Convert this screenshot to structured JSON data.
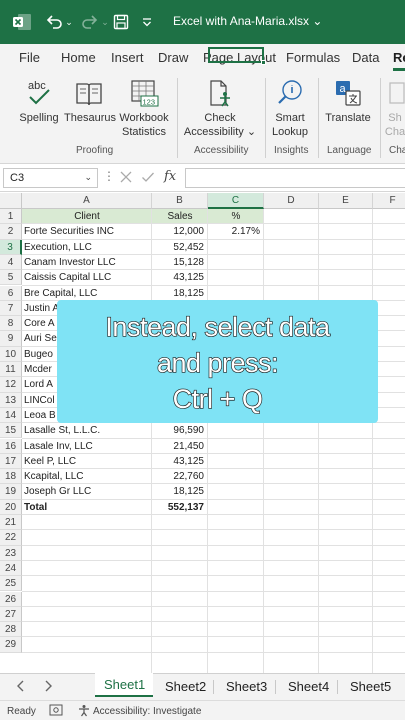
{
  "titlebar": {
    "file_name": "Excel with Ana-Maria.xlsx ⌄"
  },
  "ribbon_tabs": [
    "File",
    "Home",
    "Insert",
    "Draw",
    "Page Layout",
    "Formulas",
    "Data",
    "Re"
  ],
  "ribbon": {
    "spelling": "Spelling",
    "thesaurus": "Thesaurus",
    "workbook_statistics_1": "Workbook",
    "workbook_statistics_2": "Statistics",
    "check_accessibility_1": "Check",
    "check_accessibility_2": "Accessibility ⌄",
    "smart_lookup_1": "Smart",
    "smart_lookup_2": "Lookup",
    "translate": "Translate",
    "show_1": "Sh",
    "show_2": "Cha",
    "group_proofing": "Proofing",
    "group_accessibility": "Accessibility",
    "group_insights": "Insights",
    "group_language": "Language",
    "group_changes": "Cha",
    "stats_badge": "123",
    "abc_label": "abc"
  },
  "formula_bar": {
    "name_box": "C3",
    "fx": "fx",
    "formula": ""
  },
  "columns": [
    "A",
    "B",
    "C",
    "D",
    "E",
    "F"
  ],
  "rows": [
    "1",
    "2",
    "3",
    "4",
    "5",
    "6",
    "7",
    "8",
    "9",
    "10",
    "11",
    "12",
    "13",
    "14",
    "15",
    "16",
    "17",
    "18",
    "19",
    "20",
    "21",
    "22",
    "23",
    "24",
    "25",
    "26",
    "27",
    "28",
    "29"
  ],
  "header_row": {
    "client": "Client",
    "sales": "Sales",
    "pct": "%"
  },
  "data_rows": [
    {
      "client": "Forte Securities INC",
      "sales": "12,000",
      "pct": "2.17%"
    },
    {
      "client": "Execution, LLC",
      "sales": "52,452",
      "pct": ""
    },
    {
      "client": "Canam Investor LLC",
      "sales": "15,128",
      "pct": ""
    },
    {
      "client": "Caissis Capital LLC",
      "sales": "43,125",
      "pct": ""
    },
    {
      "client": "Bre Capital, LLC",
      "sales": "18,125",
      "pct": ""
    },
    {
      "client": "Justin A",
      "sales": "",
      "pct": ""
    },
    {
      "client": "Core A",
      "sales": "",
      "pct": ""
    },
    {
      "client": "Auri Se",
      "sales": "",
      "pct": ""
    },
    {
      "client": "Bugeo",
      "sales": "",
      "pct": ""
    },
    {
      "client": "Mcder",
      "sales": "",
      "pct": ""
    },
    {
      "client": "Lord A",
      "sales": "",
      "pct": ""
    },
    {
      "client": "LINCol",
      "sales": "",
      "pct": ""
    },
    {
      "client": "Leoa B",
      "sales": "",
      "pct": ""
    },
    {
      "client": "Lasalle St, L.L.C.",
      "sales": "96,590",
      "pct": ""
    },
    {
      "client": "Lasale Inv, LLC",
      "sales": "21,450",
      "pct": ""
    },
    {
      "client": "Keel P, LLC",
      "sales": "43,125",
      "pct": ""
    },
    {
      "client": "Kcapital, LLC",
      "sales": "22,760",
      "pct": ""
    },
    {
      "client": "Joseph Gr LLC",
      "sales": "18,125",
      "pct": ""
    }
  ],
  "total_row": {
    "label": "Total",
    "sales": "552,137"
  },
  "callout": {
    "line1": "Instead, select data",
    "line2": "and press:",
    "line3": "Ctrl + Q"
  },
  "sheets": [
    "Sheet1",
    "Sheet2",
    "Sheet3",
    "Sheet4",
    "Sheet5"
  ],
  "status": {
    "ready": "Ready",
    "accessibility": "Accessibility: Investigate"
  },
  "colors": {
    "excel_green": "#1e7145",
    "header_band": "#d9ead3",
    "callout_bg": "#7fe3f5"
  }
}
